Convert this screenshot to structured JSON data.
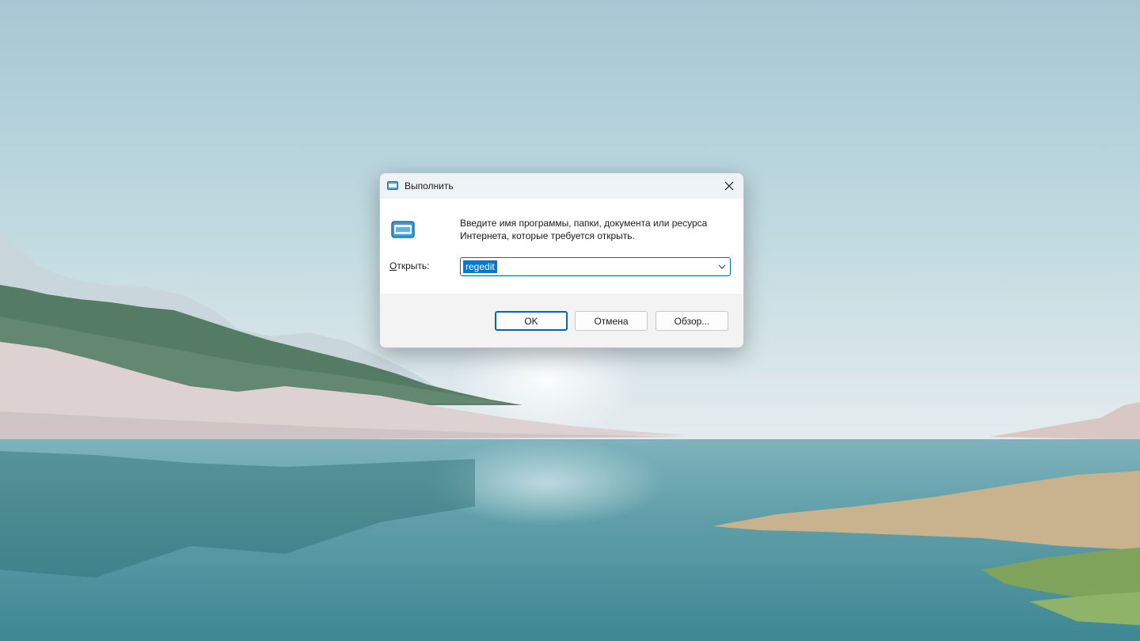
{
  "window": {
    "title": "Выполнить",
    "description": "Введите имя программы, папки, документа или ресурса Интернета, которые требуется открыть.",
    "open_label_prefix": "",
    "open_label_accel": "О",
    "open_label_rest": "ткрыть:",
    "input_value": "regedit"
  },
  "buttons": {
    "ok": "OK",
    "cancel": "Отмена",
    "browse": "Обзор..."
  },
  "icons": {
    "title_icon": "run-icon",
    "big_icon": "run-icon",
    "close_icon": "close-icon",
    "dropdown_icon": "chevron-down-icon"
  },
  "colors": {
    "accent": "#0067c0",
    "selection": "#0078d4"
  }
}
